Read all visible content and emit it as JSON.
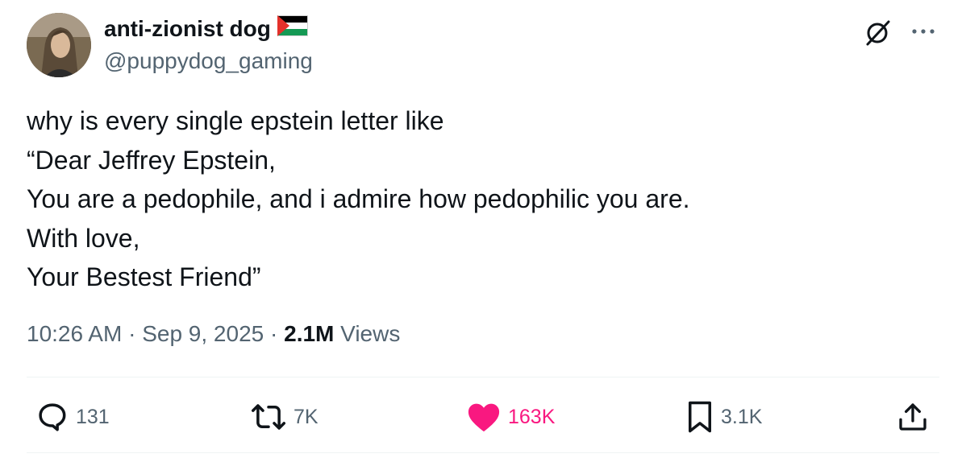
{
  "tweet": {
    "author": {
      "display_name": "anti-zionist dog",
      "flag_icon": "palestine-flag-icon",
      "handle": "@puppydog_gaming"
    },
    "text_lines": [
      "why is every single epstein letter like",
      "“Dear Jeffrey Epstein,",
      "You are a pedophile, and i admire how pedophilic you are.",
      "With love,",
      "Your Bestest Friend”"
    ],
    "time": "10:26 AM",
    "date": "Sep 9, 2025",
    "views_count": "2.1M",
    "views_label": "Views",
    "separator": "·"
  },
  "actions": {
    "replies": "131",
    "reposts": "7K",
    "likes": "163K",
    "bookmarks": "3.1K"
  },
  "icons": {
    "reply": "reply-icon",
    "repost": "repost-icon",
    "like": "heart-icon",
    "bookmark": "bookmark-icon",
    "share": "share-icon",
    "grok": "grok-icon",
    "more": "more-icon"
  },
  "colors": {
    "text": "#0f1419",
    "secondary": "#536471",
    "like": "#f91880",
    "divider": "#eff3f4"
  }
}
